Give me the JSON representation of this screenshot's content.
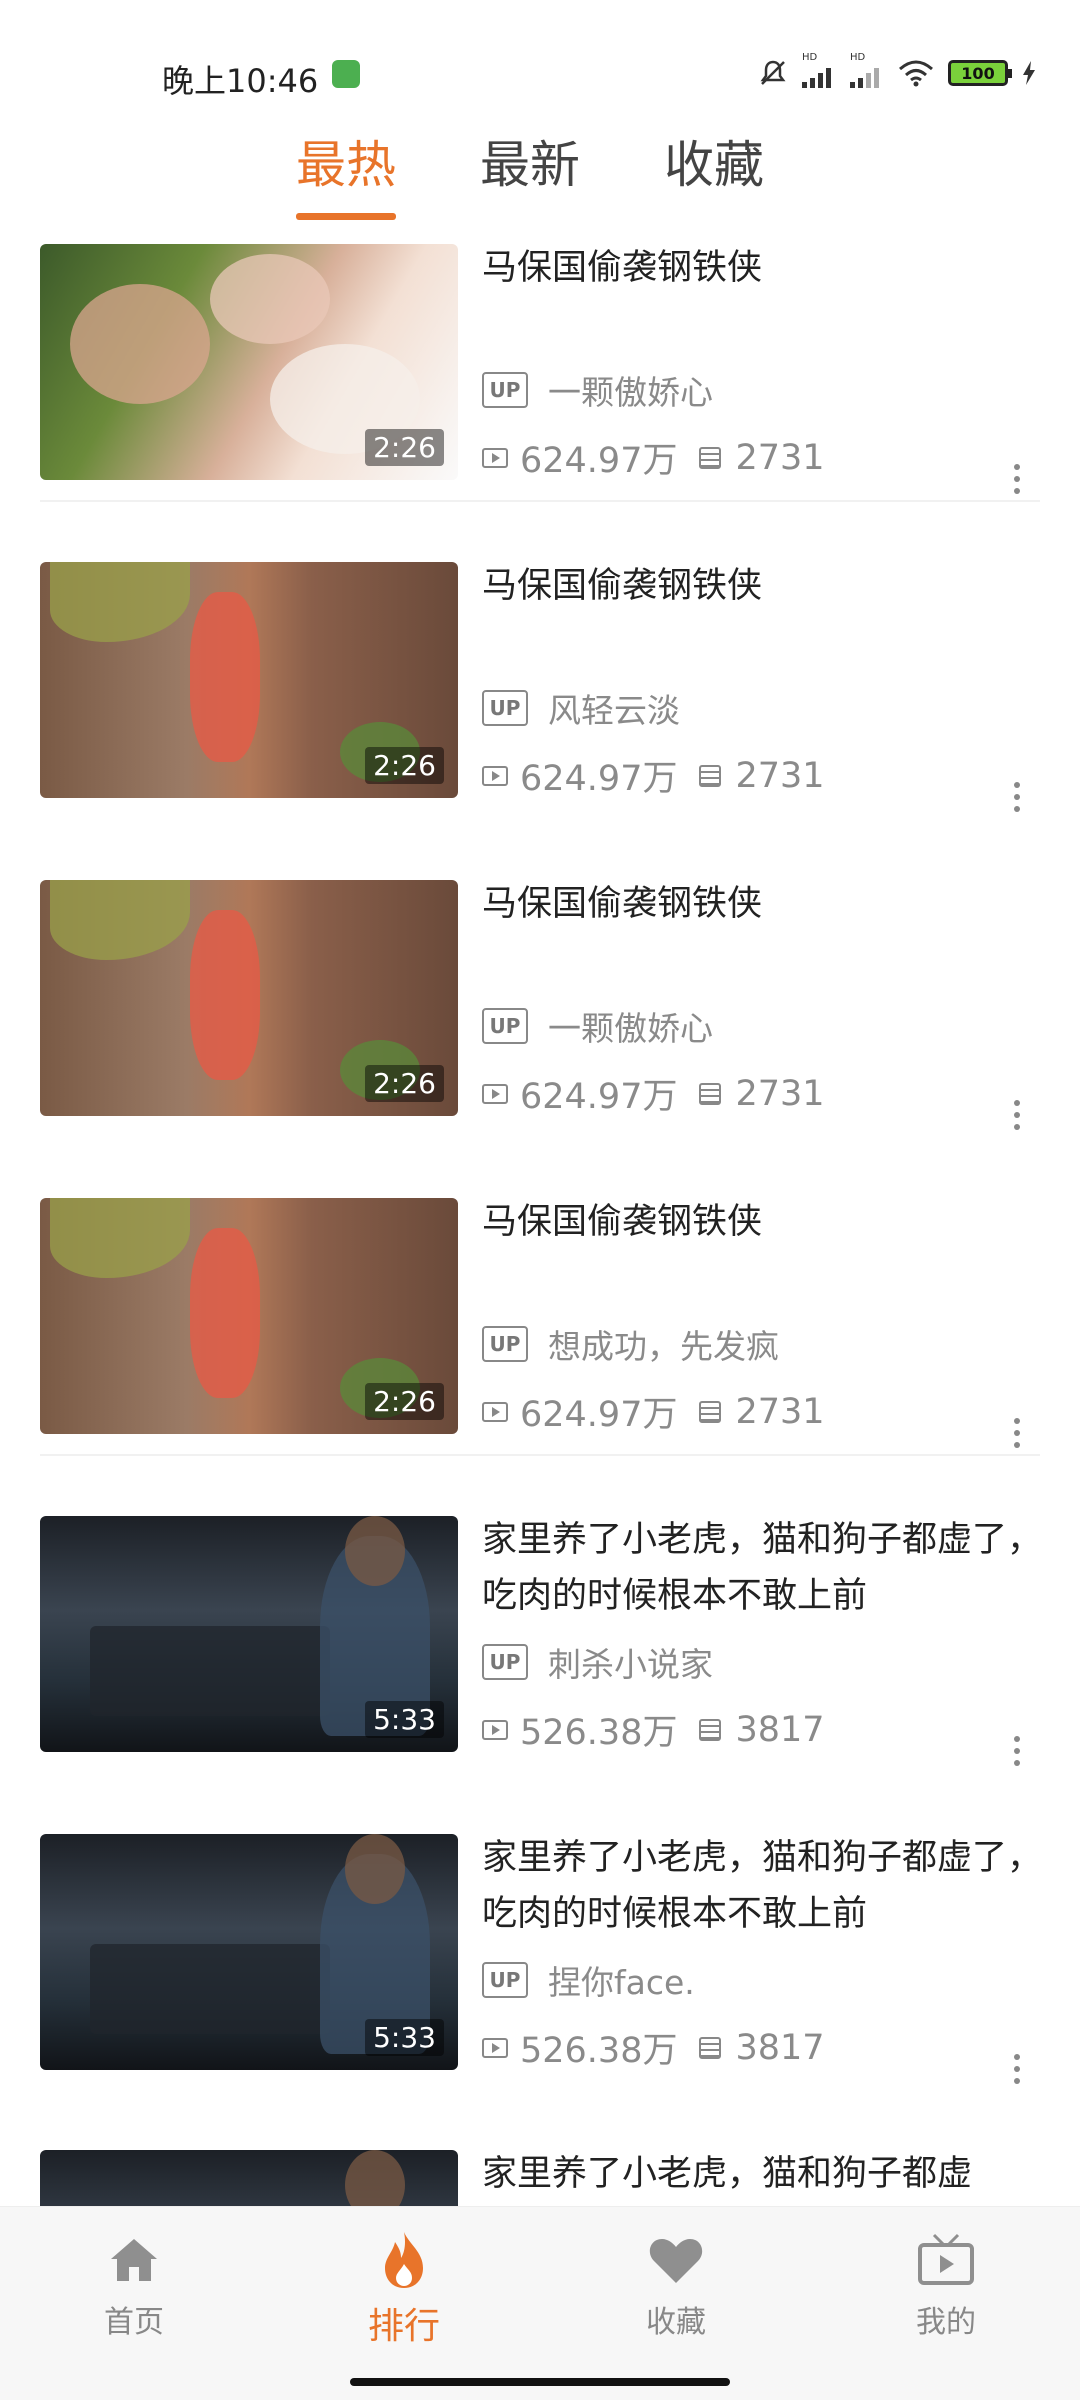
{
  "status_bar": {
    "time": "晚上10:46",
    "battery": "100"
  },
  "top_tabs": [
    {
      "label": "最热"
    },
    {
      "label": "最新"
    },
    {
      "label": "收藏"
    }
  ],
  "videos": [
    {
      "title": "马保国偷袭钢铁侠",
      "up_badge": "UP",
      "uploader": "一颗傲娇心",
      "views": "624.97万",
      "danmaku": "2731",
      "duration": "2:26",
      "thumb": "girls"
    },
    {
      "title": "马保国偷袭钢铁侠",
      "up_badge": "UP",
      "uploader": "风轻云淡",
      "views": "624.97万",
      "danmaku": "2731",
      "duration": "2:26",
      "thumb": "fence"
    },
    {
      "title": "马保国偷袭钢铁侠",
      "up_badge": "UP",
      "uploader": "一颗傲娇心",
      "views": "624.97万",
      "danmaku": "2731",
      "duration": "2:26",
      "thumb": "fence"
    },
    {
      "title": "马保国偷袭钢铁侠",
      "up_badge": "UP",
      "uploader": "想成功，先发疯",
      "views": "624.97万",
      "danmaku": "2731",
      "duration": "2:26",
      "thumb": "fence"
    },
    {
      "title": "家里养了小老虎，猫和狗子都虚了，吃肉的时候根本不敢上前",
      "up_badge": "UP",
      "uploader": "刺杀小说家",
      "views": "526.38万",
      "danmaku": "3817",
      "duration": "5:33",
      "thumb": "music"
    },
    {
      "title": "家里养了小老虎，猫和狗子都虚了，吃肉的时候根本不敢上前",
      "up_badge": "UP",
      "uploader": "捏你face.",
      "views": "526.38万",
      "danmaku": "3817",
      "duration": "5:33",
      "thumb": "music"
    },
    {
      "title": "家里养了小老虎，猫和狗子都虚",
      "thumb": "music"
    }
  ],
  "bottom_nav": [
    {
      "label": "首页",
      "icon": "home-icon"
    },
    {
      "label": "排行",
      "icon": "flame-icon"
    },
    {
      "label": "收藏",
      "icon": "heart-icon"
    },
    {
      "label": "我的",
      "icon": "tv-icon"
    }
  ],
  "colors": {
    "accent": "#e8742a",
    "muted": "#8a8a8a"
  }
}
